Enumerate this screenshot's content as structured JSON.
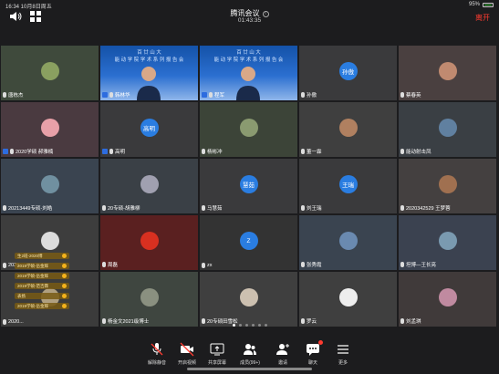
{
  "status": {
    "time_date": "16:34  10月8日周五",
    "battery": "95%"
  },
  "header": {
    "title": "腾讯会议",
    "info": "i",
    "elapsed": "01:43:35",
    "leave": "离开"
  },
  "tiles": [
    {
      "name": "唐栋杰"
    },
    {
      "name": "韩林华"
    },
    {
      "name": "程军"
    },
    {
      "name": "孙傲",
      "avatar": "孙傲"
    },
    {
      "name": "蔡春英"
    },
    {
      "name": "2020学硕 郝雅楠"
    },
    {
      "name": "高明",
      "avatar": "高明"
    },
    {
      "name": "杨彬冲"
    },
    {
      "name": "董一霖"
    },
    {
      "name": "能动射击凤"
    },
    {
      "name": "20213449专硕-刘皓"
    },
    {
      "name": "20专硕-胡雅柳"
    },
    {
      "name": "马慧茹",
      "avatar": "慧茹"
    },
    {
      "name": "刘王瑞",
      "avatar": "王瑞"
    },
    {
      "name": "2020342529 王梦蓉"
    },
    {
      "name": "2020..."
    },
    {
      "name": "周磊"
    },
    {
      "name": "zx",
      "avatar": "Z"
    },
    {
      "name": "张秀霞"
    },
    {
      "name": "坦博—王长亮"
    },
    {
      "name": "2020..."
    },
    {
      "name": "杨金文2021级博士"
    },
    {
      "name": "20专硕田雪松"
    },
    {
      "name": "罗云"
    },
    {
      "name": "刘孟琪"
    }
  ],
  "banner": {
    "line1": "百 廿 山 大",
    "line2": "能 动 学 院 学 术 系 列 报 告 会"
  },
  "chat_chips": [
    "生2班-2020博",
    "2019学硕-岳金辉",
    "2019学硕-岳金辉",
    "2019学硕-范吉霖",
    "表扬",
    "2019学硕-岳金辉"
  ],
  "toolbar": [
    {
      "label": "解除静音",
      "icon": "mic-off-icon"
    },
    {
      "label": "开启视频",
      "icon": "video-off-icon"
    },
    {
      "label": "共享屏幕",
      "icon": "share-screen-icon"
    },
    {
      "label": "成员(99+)",
      "icon": "members-icon"
    },
    {
      "label": "邀请",
      "icon": "invite-icon"
    },
    {
      "label": "聊天",
      "icon": "chat-icon"
    },
    {
      "label": "更多",
      "icon": "more-icon"
    }
  ],
  "colors": {
    "accent": "#3aa0ff",
    "leave": "#ff3b30",
    "avatar": "#2a7de1"
  }
}
